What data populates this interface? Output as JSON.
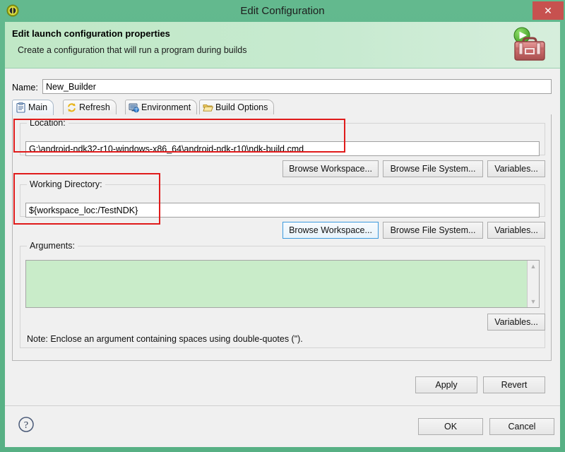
{
  "window": {
    "title": "Edit Configuration",
    "icon": "eclipse-window-icon",
    "close_label": "✕",
    "frame_color": "#57b084",
    "close_color": "#c7514f"
  },
  "header": {
    "title": "Edit launch configuration properties",
    "description": "Create a configuration that will run a program during builds",
    "icon": "toolbox-run-icon",
    "background_color": "#c7ead0"
  },
  "name_field": {
    "label": "Name:",
    "value": "New_Builder",
    "placeholder": ""
  },
  "tabs": [
    {
      "label": "Main",
      "icon": "clipboard-icon",
      "active": true
    },
    {
      "label": "Refresh",
      "icon": "refresh-arrows-icon",
      "active": false
    },
    {
      "label": "Environment",
      "icon": "environment-monitor-icon",
      "active": false
    },
    {
      "label": "Build Options",
      "icon": "open-folder-icon",
      "active": false
    }
  ],
  "location_group": {
    "title": "Location:",
    "value": "G:\\android-ndk32-r10-windows-x86_64\\android-ndk-r10\\ndk-build.cmd",
    "placeholder": "",
    "highlighted": true,
    "buttons": [
      {
        "label": "Browse Workspace...",
        "focused": false
      },
      {
        "label": "Browse File System...",
        "focused": false
      },
      {
        "label": "Variables...",
        "focused": false
      }
    ]
  },
  "working_directory_group": {
    "title": "Working Directory:",
    "value": "${workspace_loc:/TestNDK}",
    "placeholder": "",
    "highlighted": true,
    "buttons": [
      {
        "label": "Browse Workspace...",
        "focused": true
      },
      {
        "label": "Browse File System...",
        "focused": false
      },
      {
        "label": "Variables...",
        "focused": false
      }
    ]
  },
  "arguments_group": {
    "title": "Arguments:",
    "value": "",
    "placeholder": "",
    "background_color": "#c9ecc9",
    "scrollbar": {
      "up": "▲",
      "down": "▼"
    },
    "variables_button": "Variables...",
    "note": "Note: Enclose an argument containing spaces using double-quotes (\")."
  },
  "config_buttons": [
    {
      "label": "Apply"
    },
    {
      "label": "Revert"
    }
  ],
  "footer": {
    "help_icon": "help-question-icon",
    "buttons": [
      {
        "label": "OK"
      },
      {
        "label": "Cancel"
      }
    ]
  },
  "annotation": {
    "color": "#e01b1b",
    "boxes": [
      "location-highlight",
      "working-directory-highlight"
    ]
  }
}
